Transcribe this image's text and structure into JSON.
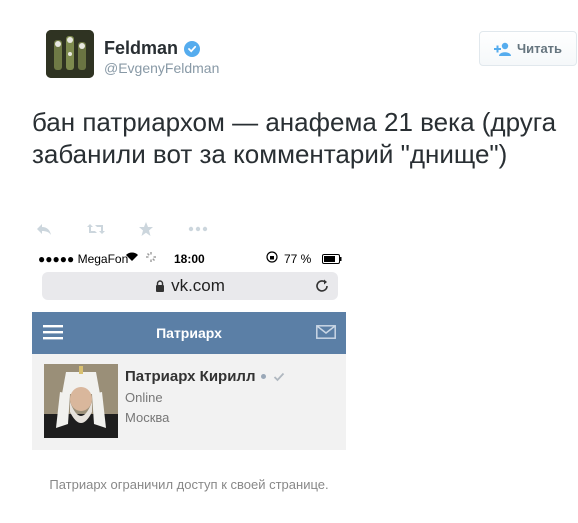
{
  "user": {
    "name": "Feldman",
    "handle": "@EvgenyFeldman"
  },
  "follow_button": {
    "label": "Читать"
  },
  "tweet": {
    "text": "бан патриархом — анафема 21 века (друга забанили вот за комментарий \"днище\")"
  },
  "actions": {
    "icons": [
      "reply-icon",
      "retweet-icon",
      "favorite-icon",
      "more-icon"
    ]
  },
  "screenshot": {
    "status_bar": {
      "carrier": "●●●●● MegaFon",
      "time": "18:00",
      "battery": "77 %"
    },
    "url": "vk.com",
    "vk_header_title": "Патриарх",
    "profile": {
      "name": "Патриарх Кирилл",
      "status": "Online",
      "city": "Москва"
    },
    "restricted_message": "Патриарх ограничил доступ к своей странице."
  },
  "colors": {
    "twitter_blue": "#55acee",
    "vk_blue": "#5b7fa6",
    "text_dark": "#292f33",
    "text_gray": "#8899a6"
  }
}
